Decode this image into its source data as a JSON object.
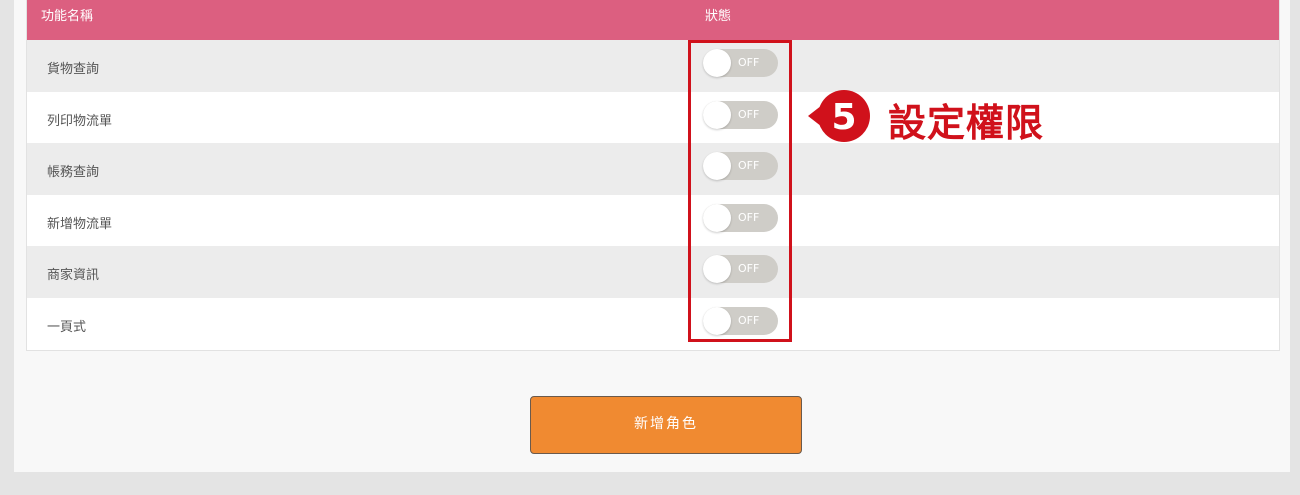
{
  "table": {
    "header": {
      "col_name": "功能名稱",
      "col_status": "狀態"
    },
    "rows": [
      {
        "name": "貨物查詢",
        "status": "OFF"
      },
      {
        "name": "列印物流單",
        "status": "OFF"
      },
      {
        "name": "帳務查詢",
        "status": "OFF"
      },
      {
        "name": "新增物流單",
        "status": "OFF"
      },
      {
        "name": "商家資訊",
        "status": "OFF"
      },
      {
        "name": "一頁式",
        "status": "OFF"
      }
    ]
  },
  "callout": {
    "step": "5",
    "text": "設定權限",
    "color": "#d0111b"
  },
  "add_role_button": "新增角色",
  "colors": {
    "header": "#dc5f80",
    "button": "#f08a31",
    "toggle_off": "#cfcdc8"
  }
}
